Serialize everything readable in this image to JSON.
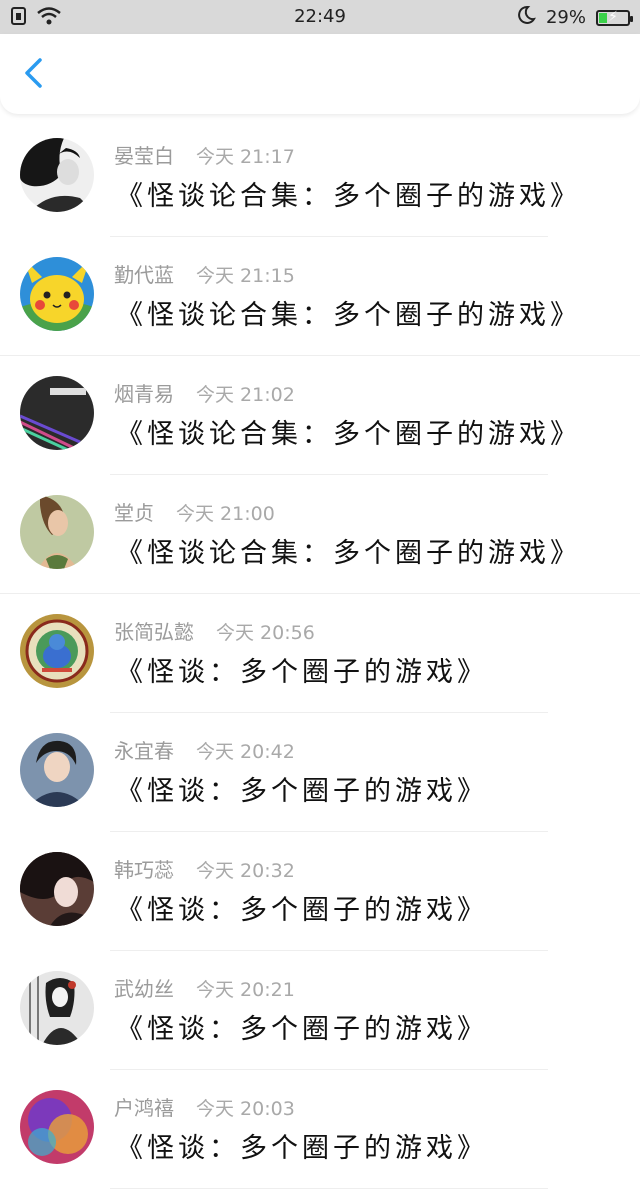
{
  "status_bar": {
    "time": "22:49",
    "battery_percent": "29%",
    "battery_level": 0.29,
    "icons": [
      "sim-icon",
      "wifi-icon",
      "moon-icon",
      "battery-icon"
    ]
  },
  "nav": {
    "back_icon": "chevron-left-icon",
    "accent": "#2a9bf0"
  },
  "items": [
    {
      "name": "晏莹白",
      "time": "今天 21:17",
      "title": "《怪谈论合集：多个圈子的游戏》"
    },
    {
      "name": "勤代蓝",
      "time": "今天 21:15",
      "title": "《怪谈论合集：多个圈子的游戏》"
    },
    {
      "name": "烟青易",
      "time": "今天 21:02",
      "title": "《怪谈论合集：多个圈子的游戏》"
    },
    {
      "name": "堂贞",
      "time": "今天 21:00",
      "title": "《怪谈论合集：多个圈子的游戏》"
    },
    {
      "name": "张简弘懿",
      "time": "今天 20:56",
      "title": "《怪谈：多个圈子的游戏》"
    },
    {
      "name": "永宜春",
      "time": "今天 20:42",
      "title": "《怪谈：多个圈子的游戏》"
    },
    {
      "name": "韩巧蕊",
      "time": "今天 20:32",
      "title": "《怪谈：多个圈子的游戏》"
    },
    {
      "name": "武幼丝",
      "time": "今天 20:21",
      "title": "《怪谈：多个圈子的游戏》"
    },
    {
      "name": "户鸿禧",
      "time": "今天 20:03",
      "title": "《怪谈：多个圈子的游戏》"
    }
  ]
}
